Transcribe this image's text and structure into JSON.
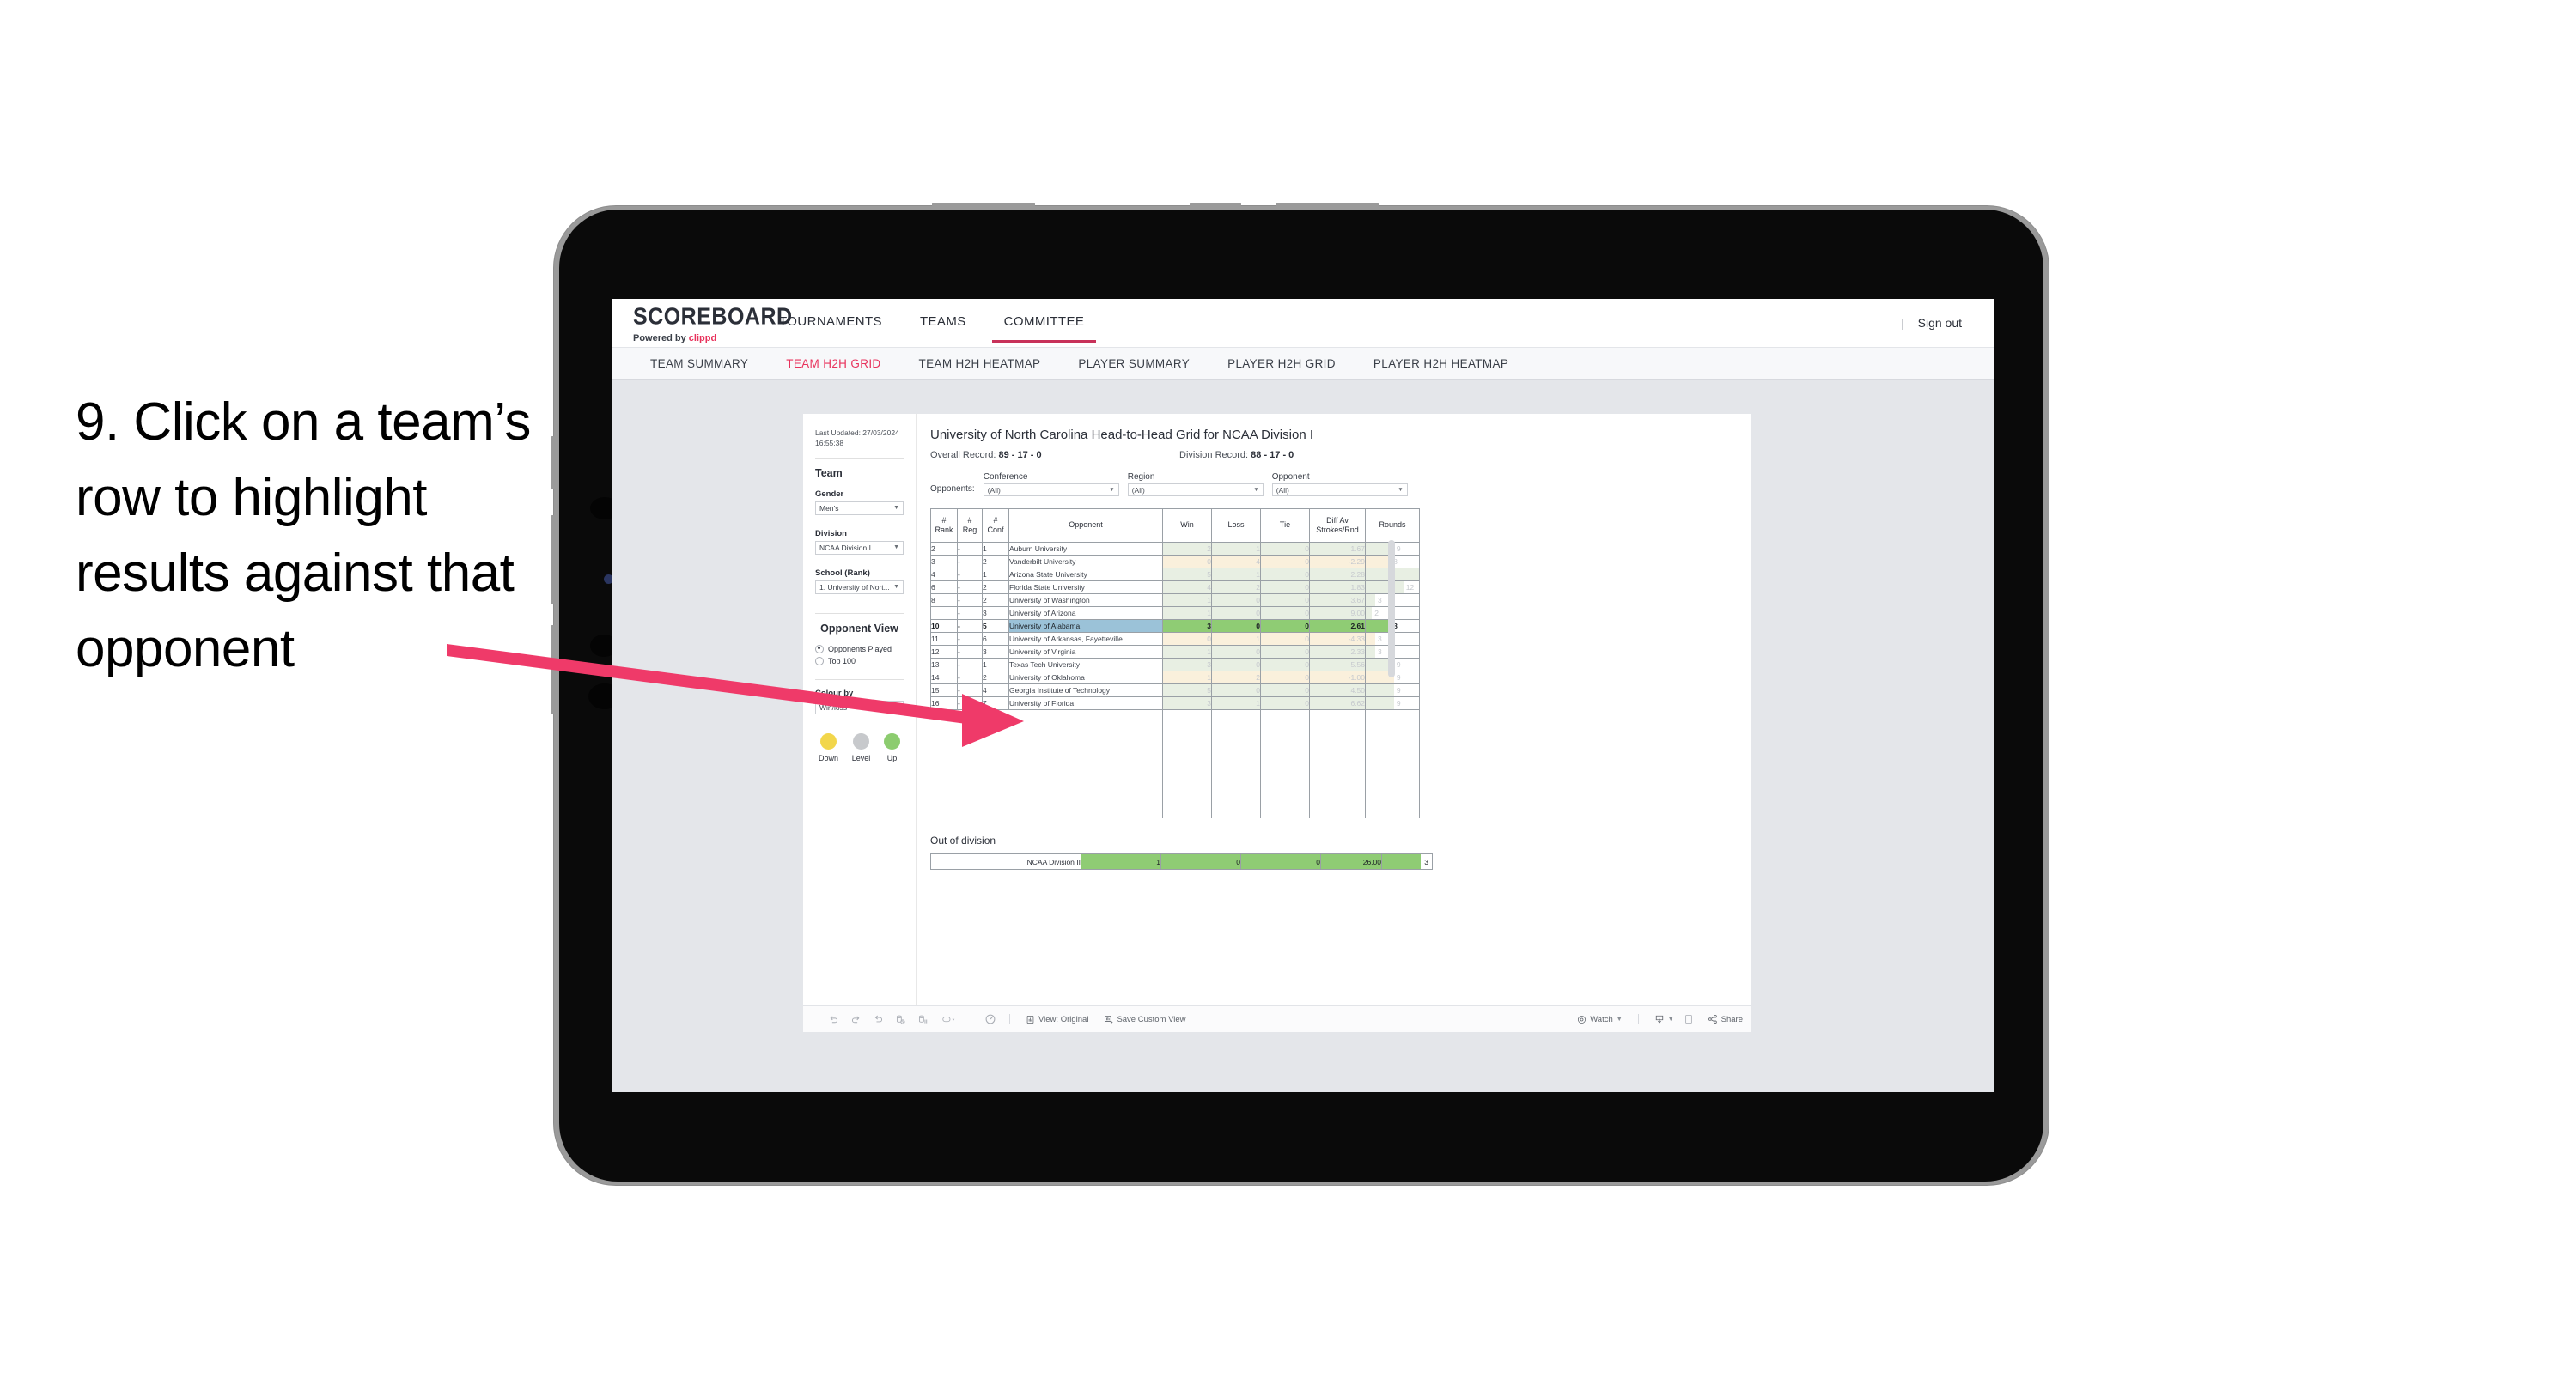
{
  "instruction": {
    "text": "9. Click on a team’s row to highlight results against that opponent",
    "arrow_color": "#ef3a69"
  },
  "header": {
    "logo_word": "SCOREBOARD",
    "logo_sub_prefix": "Powered by ",
    "logo_sub_brand": "clippd",
    "nav": [
      {
        "label": "TOURNAMENTS",
        "active": false
      },
      {
        "label": "TEAMS",
        "active": false
      },
      {
        "label": "COMMITTEE",
        "active": true
      }
    ],
    "divider": "|",
    "sign_out": "Sign out",
    "accent_color": "#c8325a"
  },
  "subnav": {
    "items": [
      {
        "label": "TEAM SUMMARY",
        "active": false
      },
      {
        "label": "TEAM H2H GRID",
        "active": true
      },
      {
        "label": "TEAM H2H HEATMAP",
        "active": false
      },
      {
        "label": "PLAYER SUMMARY",
        "active": false
      },
      {
        "label": "PLAYER H2H GRID",
        "active": false
      },
      {
        "label": "PLAYER H2H HEATMAP",
        "active": false
      }
    ]
  },
  "sidebar": {
    "last_updated_line1": "Last Updated: 27/03/2024",
    "last_updated_line2": "16:55:38",
    "team_heading": "Team",
    "gender_label": "Gender",
    "gender_value": "Men’s",
    "division_label": "Division",
    "division_value": "NCAA Division I",
    "school_label": "School (Rank)",
    "school_value": "1. University of Nort...",
    "opponent_view_heading": "Opponent View",
    "opponent_view_options": [
      {
        "label": "Opponents Played",
        "selected": true
      },
      {
        "label": "Top 100",
        "selected": false
      }
    ],
    "colour_by_label": "Colour by",
    "colour_by_value": "Win/loss",
    "legend": [
      {
        "label": "Down",
        "color": "#f2d64b"
      },
      {
        "label": "Level",
        "color": "#c7c9cc"
      },
      {
        "label": "Up",
        "color": "#8ccc6f"
      }
    ]
  },
  "main": {
    "title": "University of North Carolina Head-to-Head Grid for NCAA Division I",
    "overall_record_label": "Overall Record:",
    "overall_record_value": "89 - 17 - 0",
    "division_record_label": "Division Record:",
    "division_record_value": "88 - 17 - 0",
    "opponents_label": "Opponents:",
    "filters": [
      {
        "name": "Conference",
        "value": "(All)"
      },
      {
        "name": "Region",
        "value": "(All)"
      },
      {
        "name": "Opponent",
        "value": "(All)"
      }
    ],
    "columns": [
      "# Rank",
      "# Reg",
      "# Conf",
      "Opponent",
      "Win",
      "Loss",
      "Tie",
      "Diff Av Strokes/Rnd",
      "Rounds"
    ],
    "columns_split": [
      [
        "#",
        "Rank"
      ],
      [
        "#",
        "Reg"
      ],
      [
        "#",
        "Conf"
      ],
      [
        "Opponent",
        ""
      ],
      [
        "Win",
        ""
      ],
      [
        "Loss",
        ""
      ],
      [
        "Tie",
        ""
      ],
      [
        "Diff Av",
        "Strokes/Rnd"
      ],
      [
        "Rounds",
        ""
      ]
    ],
    "rows": [
      {
        "rank": "2",
        "reg": "-",
        "conf": "1",
        "opponent": "Auburn University",
        "win": "2",
        "loss": "1",
        "tie": "0",
        "diff": "1.67",
        "rounds": "9",
        "trend": "up",
        "selected": false
      },
      {
        "rank": "3",
        "reg": "-",
        "conf": "2",
        "opponent": "Vanderbilt University",
        "win": "0",
        "loss": "4",
        "tie": "0",
        "diff": "-2.29",
        "rounds": "8",
        "trend": "down",
        "selected": false
      },
      {
        "rank": "4",
        "reg": "-",
        "conf": "1",
        "opponent": "Arizona State University",
        "win": "5",
        "loss": "1",
        "tie": "0",
        "diff": "2.28",
        "rounds": "17",
        "trend": "up",
        "selected": false
      },
      {
        "rank": "6",
        "reg": "-",
        "conf": "2",
        "opponent": "Florida State University",
        "win": "4",
        "loss": "2",
        "tie": "0",
        "diff": "1.83",
        "rounds": "12",
        "trend": "up",
        "selected": false
      },
      {
        "rank": "8",
        "reg": "-",
        "conf": "2",
        "opponent": "University of Washington",
        "win": "1",
        "loss": "0",
        "tie": "0",
        "diff": "3.67",
        "rounds": "3",
        "trend": "up",
        "selected": false
      },
      {
        "rank": "",
        "reg": "-",
        "conf": "3",
        "opponent": "University of Arizona",
        "win": "1",
        "loss": "0",
        "tie": "0",
        "diff": "9.00",
        "rounds": "2",
        "trend": "up",
        "selected": false
      },
      {
        "rank": "10",
        "reg": "-",
        "conf": "5",
        "opponent": "University of Alabama",
        "win": "3",
        "loss": "0",
        "tie": "0",
        "diff": "2.61",
        "rounds": "8",
        "trend": "up",
        "selected": true
      },
      {
        "rank": "11",
        "reg": "-",
        "conf": "6",
        "opponent": "University of Arkansas, Fayetteville",
        "win": "0",
        "loss": "1",
        "tie": "0",
        "diff": "-4.33",
        "rounds": "3",
        "trend": "down",
        "selected": false
      },
      {
        "rank": "12",
        "reg": "-",
        "conf": "3",
        "opponent": "University of Virginia",
        "win": "1",
        "loss": "0",
        "tie": "0",
        "diff": "2.33",
        "rounds": "3",
        "trend": "up",
        "selected": false
      },
      {
        "rank": "13",
        "reg": "-",
        "conf": "1",
        "opponent": "Texas Tech University",
        "win": "3",
        "loss": "0",
        "tie": "0",
        "diff": "5.56",
        "rounds": "9",
        "trend": "up",
        "selected": false
      },
      {
        "rank": "14",
        "reg": "-",
        "conf": "2",
        "opponent": "University of Oklahoma",
        "win": "1",
        "loss": "2",
        "tie": "0",
        "diff": "-1.00",
        "rounds": "9",
        "trend": "down",
        "selected": false
      },
      {
        "rank": "15",
        "reg": "-",
        "conf": "4",
        "opponent": "Georgia Institute of Technology",
        "win": "5",
        "loss": "0",
        "tie": "0",
        "diff": "4.50",
        "rounds": "9",
        "trend": "up",
        "selected": false
      },
      {
        "rank": "16",
        "reg": "-",
        "conf": "7",
        "opponent": "University of Florida",
        "win": "3",
        "loss": "1",
        "tie": "0",
        "diff": "6.62",
        "rounds": "9",
        "trend": "up",
        "selected": false
      }
    ],
    "out_of_division_title": "Out of division",
    "out_of_division_row": {
      "label": "NCAA Division II",
      "win": "1",
      "loss": "0",
      "tie": "0",
      "diff": "26.00",
      "rounds": "3"
    }
  },
  "toolbar": {
    "icons": [
      "undo-icon",
      "redo-icon",
      "revert-icon",
      "refresh-data-icon",
      "pause-auto-update-icon",
      "presentation-mode-icon"
    ],
    "view_original_label": "View: Original",
    "save_custom_view_label": "Save Custom View",
    "watch_label": "Watch",
    "share_label": "Share"
  },
  "chart_data": {
    "type": "table",
    "title": "University of North Carolina Head-to-Head Grid for NCAA Division I",
    "columns": [
      "# Rank",
      "# Reg",
      "# Conf",
      "Opponent",
      "Win",
      "Loss",
      "Tie",
      "Diff Av Strokes/Rnd",
      "Rounds"
    ],
    "rows": [
      [
        "2",
        "-",
        "1",
        "Auburn University",
        2,
        1,
        0,
        1.67,
        9
      ],
      [
        "3",
        "-",
        "2",
        "Vanderbilt University",
        0,
        4,
        0,
        -2.29,
        8
      ],
      [
        "4",
        "-",
        "1",
        "Arizona State University",
        5,
        1,
        0,
        2.28,
        17
      ],
      [
        "6",
        "-",
        "2",
        "Florida State University",
        4,
        2,
        0,
        1.83,
        12
      ],
      [
        "8",
        "-",
        "2",
        "University of Washington",
        1,
        0,
        0,
        3.67,
        3
      ],
      [
        "",
        "-",
        "3",
        "University of Arizona",
        1,
        0,
        0,
        9.0,
        2
      ],
      [
        "10",
        "-",
        "5",
        "University of Alabama",
        3,
        0,
        0,
        2.61,
        8
      ],
      [
        "11",
        "-",
        "6",
        "University of Arkansas, Fayetteville",
        0,
        1,
        0,
        -4.33,
        3
      ],
      [
        "12",
        "-",
        "3",
        "University of Virginia",
        1,
        0,
        0,
        2.33,
        3
      ],
      [
        "13",
        "-",
        "1",
        "Texas Tech University",
        3,
        0,
        0,
        5.56,
        9
      ],
      [
        "14",
        "-",
        "2",
        "University of Oklahoma",
        1,
        2,
        0,
        -1.0,
        9
      ],
      [
        "15",
        "-",
        "4",
        "Georgia Institute of Technology",
        5,
        0,
        0,
        4.5,
        9
      ],
      [
        "16",
        "-",
        "7",
        "University of Florida",
        3,
        1,
        0,
        6.62,
        9
      ]
    ],
    "out_of_division": [
      [
        "NCAA Division II",
        1,
        0,
        0,
        26.0,
        3
      ]
    ],
    "highlighted_row": "University of Alabama",
    "colour_encoding": "Win/loss",
    "legend": [
      "Down",
      "Level",
      "Up"
    ],
    "max_rounds_for_bar": 17
  }
}
